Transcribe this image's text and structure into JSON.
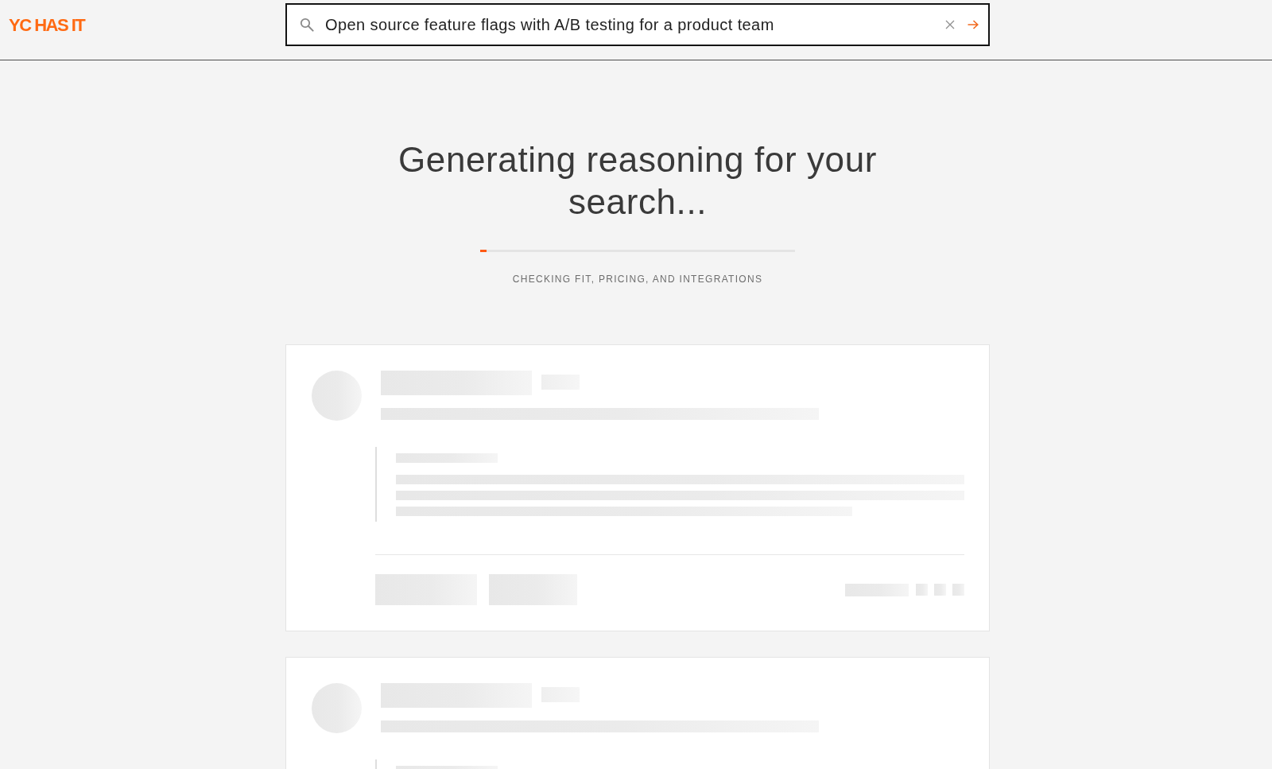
{
  "header": {
    "logo": "YC HAS IT"
  },
  "search": {
    "value": "Open source feature flags with A/B testing for a product team"
  },
  "loading": {
    "title": "Generating reasoning for your search...",
    "progress": {
      "level": 0.02
    },
    "status": "CHECKING FIT, PRICING, AND INTEGRATIONS"
  },
  "result_cards": [
    {
      "kind": "skeleton"
    },
    {
      "kind": "skeleton"
    }
  ]
}
